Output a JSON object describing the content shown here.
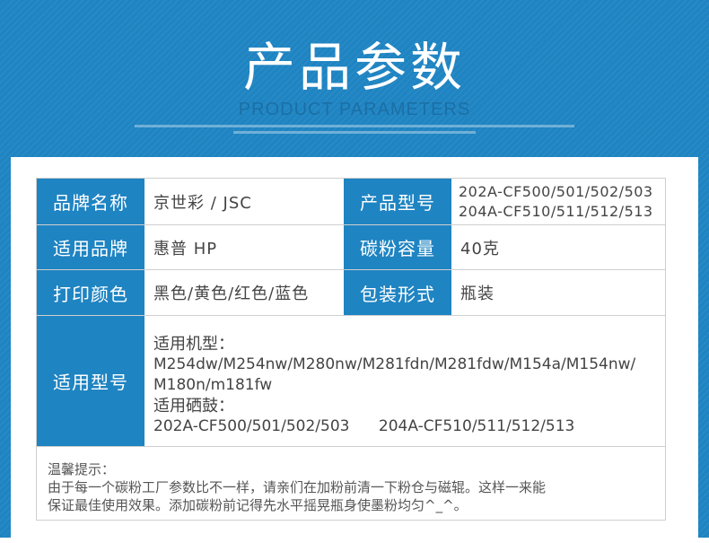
{
  "header": {
    "title_cn": "产品参数",
    "title_en": "PRODUCT PARAMETERS"
  },
  "table": {
    "rows": [
      {
        "left_label": "品牌名称",
        "left_value": "京世彩 / JSC",
        "right_label": "产品型号",
        "right_value_lines": [
          "202A-CF500/501/502/503",
          "204A-CF510/511/512/513"
        ]
      },
      {
        "left_label": "适用品牌",
        "left_value": "惠普 HP",
        "right_label": "碳粉容量",
        "right_value": "40克"
      },
      {
        "left_label": "打印颜色",
        "left_value": "黑色/黄色/红色/蓝色",
        "right_label": "包装形式",
        "right_value": "瓶装"
      }
    ],
    "models": {
      "label": "适用型号",
      "machine_title": "适用机型：",
      "machine_line1": "M254dw/M254nw/M280nw/M281fdn/M281fdw/M154a/M154nw/",
      "machine_line2": "M180n/m181fw",
      "drum_title": "适用硒鼓：",
      "drum_line": "202A-CF500/501/502/503      204A-CF510/511/512/513"
    }
  },
  "tip": {
    "title": "温馨提示：",
    "line1": "由于每一个碳粉工厂参数比不一样，请亲们在加粉前清一下粉仓与磁辊。这样一来能",
    "line2": "保证最佳使用效果。添加碳粉前记得先水平摇晃瓶身使墨粉均匀^_^。"
  },
  "colors": {
    "accent": "#1f84c2",
    "border": "#cfcfcf",
    "text": "#444444"
  }
}
